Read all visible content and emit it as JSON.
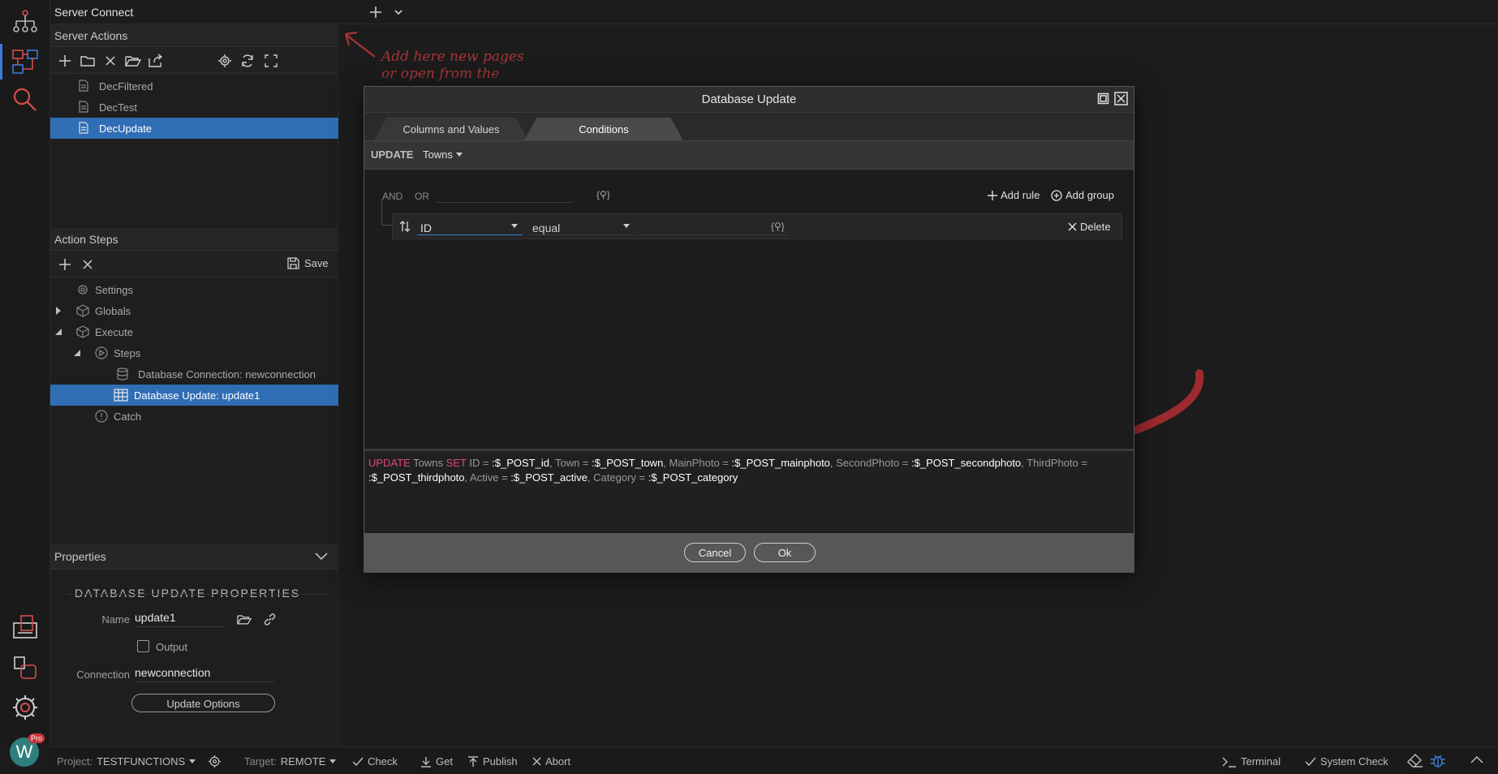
{
  "topbar": {
    "title": "Server Connect"
  },
  "server_actions": {
    "header": "Server Actions",
    "items": [
      "DecFiltered",
      "DecTest",
      "DecUpdate"
    ],
    "selected": "DecUpdate"
  },
  "annotation": {
    "line1": "Add here new pages",
    "line2": "or open from the"
  },
  "action_steps": {
    "header": "Action Steps",
    "save_label": "Save",
    "tree": {
      "settings": "Settings",
      "globals": "Globals",
      "execute": "Execute",
      "steps": "Steps",
      "db_connection": "Database Connection: newconnection",
      "db_update": "Database Update: update1",
      "catch": "Catch"
    }
  },
  "properties": {
    "header": "Properties",
    "section_title": "DATABASE UPDATE PROPERTIES",
    "name_label": "Name",
    "name_value": "update1",
    "output_label": "Output",
    "connection_label": "Connection",
    "connection_value": "newconnection",
    "update_options_label": "Update Options"
  },
  "dialog": {
    "title": "Database Update",
    "tabs": [
      "Columns and Values",
      "Conditions"
    ],
    "active_tab": "Conditions",
    "update_keyword": "UPDATE",
    "table": "Towns",
    "and_label": "AND",
    "or_label": "OR",
    "add_rule": "Add rule",
    "add_group": "Add group",
    "rule": {
      "field": "ID",
      "operator": "equal",
      "value": "",
      "delete_label": "Delete"
    },
    "sql": {
      "kw_update": "UPDATE",
      "table": "Towns",
      "kw_set": "SET",
      "p1": "ID = ",
      "v1": ":$_POST_id",
      "p2": ", Town = ",
      "v2": ":$_POST_town",
      "p3": ", MainPhoto = ",
      "v3": ":$_POST_mainphoto",
      "p4": ", SecondPhoto = ",
      "v4": ":$_POST_secondphoto",
      "p5": ", ThirdPhoto = ",
      "v5": ":$_POST_thirdphoto",
      "p6": ", Active = ",
      "v6": ":$_POST_active",
      "p7": ", Category = ",
      "v7": ":$_POST_category"
    },
    "cancel_label": "Cancel",
    "ok_label": "Ok"
  },
  "statusbar": {
    "project_label": "Project:",
    "project_value": "TESTFUNCTIONS",
    "target_label": "Target:",
    "target_value": "REMOTE",
    "check": "Check",
    "get": "Get",
    "publish": "Publish",
    "abort": "Abort",
    "terminal": "Terminal",
    "system_check": "System Check"
  },
  "badge": "Pro",
  "colors": {
    "accent": "#2f6db5",
    "annotation": "#a8353a",
    "sql_keyword": "#e0497a"
  }
}
